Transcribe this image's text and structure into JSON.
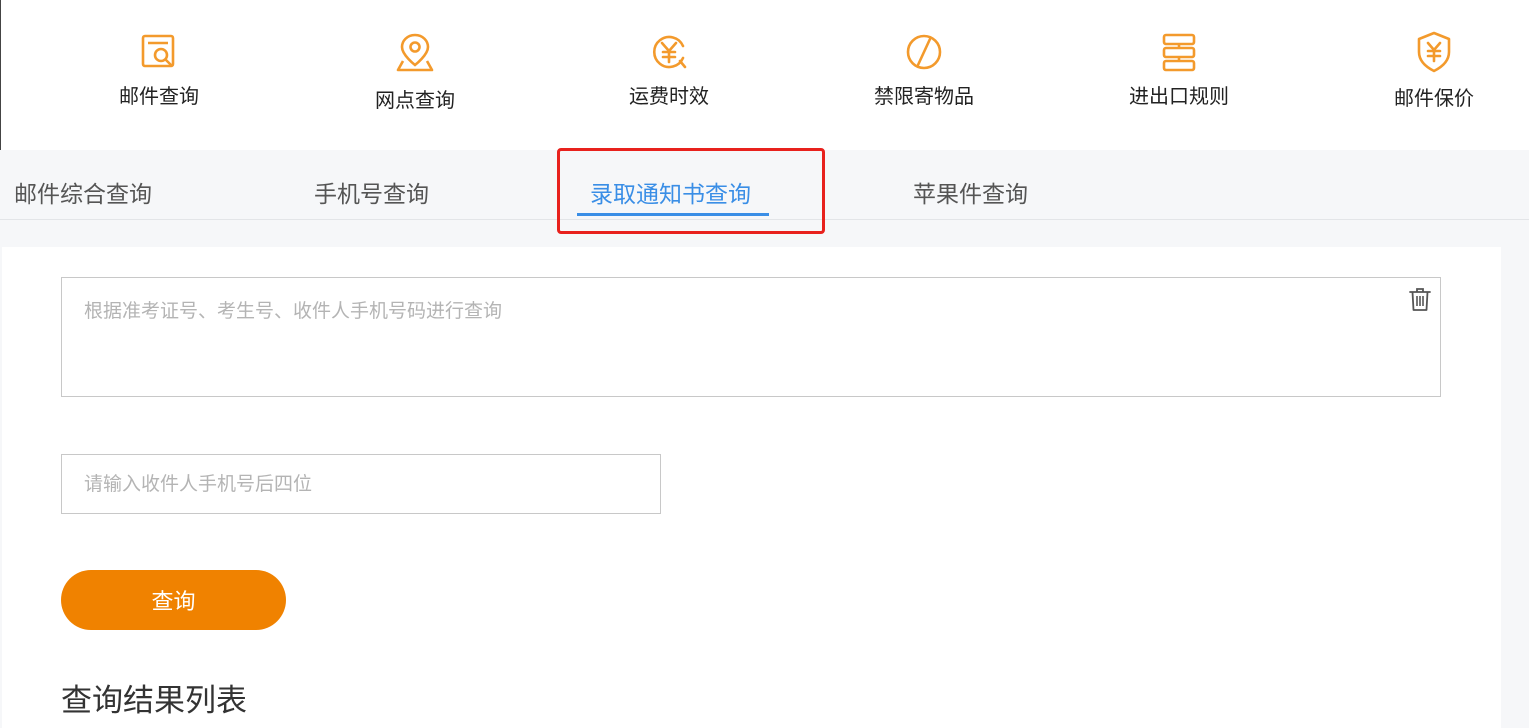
{
  "colors": {
    "accent_orange": "#f08200",
    "icon_orange": "#f39a2c",
    "active_tab_blue": "#3a8ee6",
    "highlight_red": "#e8211d"
  },
  "services": [
    {
      "label": "邮件查询",
      "icon": "mail-search-icon"
    },
    {
      "label": "网点查询",
      "icon": "location-pin-icon"
    },
    {
      "label": "运费时效",
      "icon": "yuan-clock-icon"
    },
    {
      "label": "禁限寄物品",
      "icon": "prohibited-icon"
    },
    {
      "label": "进出口规则",
      "icon": "rules-icon"
    },
    {
      "label": "邮件保价",
      "icon": "yuan-shield-icon"
    }
  ],
  "tabs": [
    {
      "label": "邮件综合查询",
      "active": false
    },
    {
      "label": "手机号查询",
      "active": false
    },
    {
      "label": "录取通知书查询",
      "active": true
    },
    {
      "label": "苹果件查询",
      "active": false
    }
  ],
  "form": {
    "query_placeholder": "根据准考证号、考生号、收件人手机号码进行查询",
    "query_value": "",
    "phone_placeholder": "请输入收件人手机号后四位",
    "phone_value": "",
    "submit_label": "查询"
  },
  "results": {
    "title": "查询结果列表"
  }
}
